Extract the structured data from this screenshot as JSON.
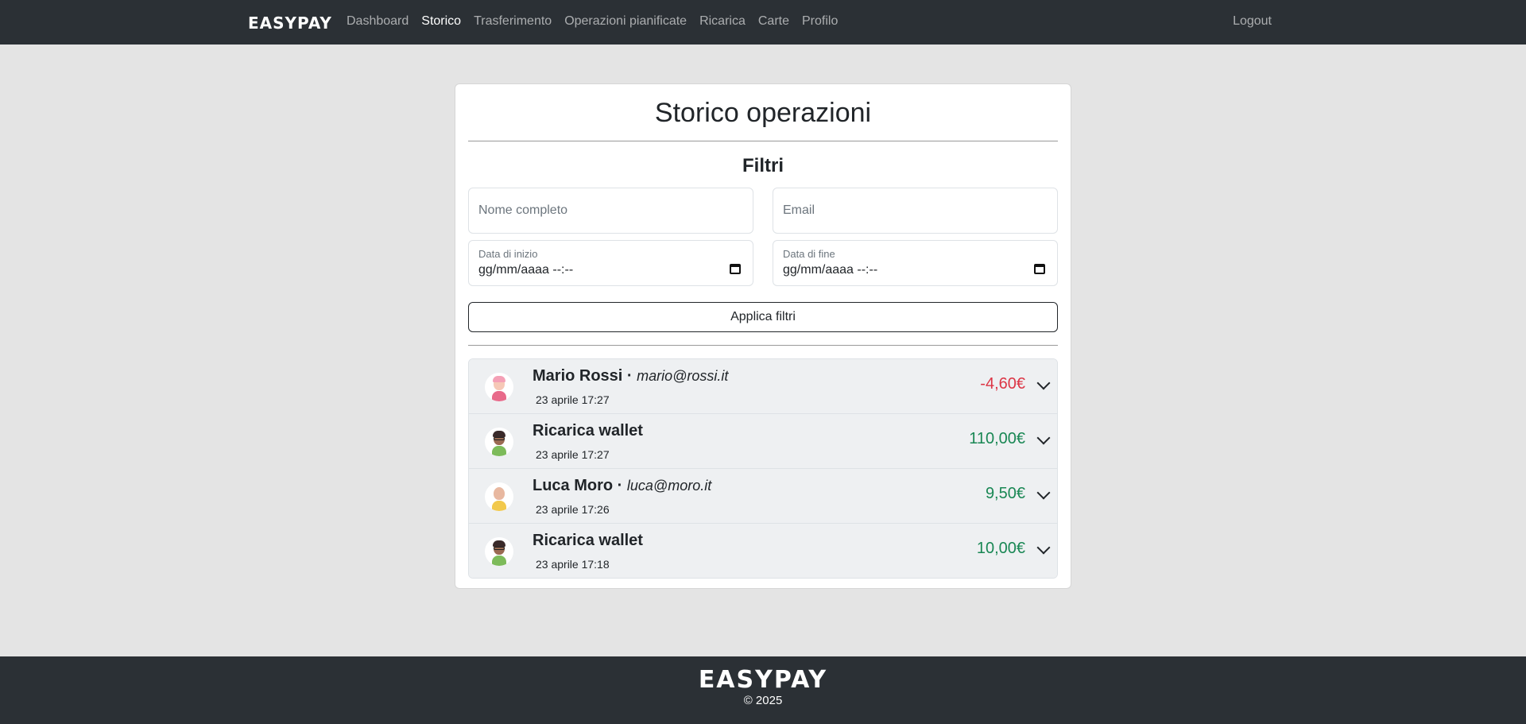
{
  "nav": {
    "brand": "EASYPAY",
    "links": [
      "Dashboard",
      "Storico",
      "Trasferimento",
      "Operazioni pianificate",
      "Ricarica",
      "Carte",
      "Profilo"
    ],
    "active": "Storico",
    "logout": "Logout"
  },
  "main": {
    "title": "Storico operazioni",
    "filters_title": "Filtri",
    "name_placeholder": "Nome completo",
    "email_placeholder": "Email",
    "start_label": "Data di inizio",
    "start_value": "gg/mm/aaaa --:--",
    "end_label": "Data di fine",
    "end_value": "gg/mm/aaaa --:--",
    "apply_label": "Applica filtri"
  },
  "transactions": [
    {
      "name": "Mario Rossi",
      "separator": " · ",
      "email": "mario@rossi.it",
      "date": "23 aprile 17:27",
      "amount": "-4,60€",
      "type": "neg",
      "avatar": "pink-haired-avatar"
    },
    {
      "name": "Ricarica wallet",
      "separator": "",
      "email": "",
      "date": "23 aprile 17:27",
      "amount": "110,00€",
      "type": "pos",
      "avatar": "glasses-avatar"
    },
    {
      "name": "Luca Moro",
      "separator": " · ",
      "email": "luca@moro.it",
      "date": "23 aprile 17:26",
      "amount": "9,50€",
      "type": "pos",
      "avatar": "bald-avatar"
    },
    {
      "name": "Ricarica wallet",
      "separator": "",
      "email": "",
      "date": "23 aprile 17:18",
      "amount": "10,00€",
      "type": "pos",
      "avatar": "glasses-avatar"
    }
  ],
  "colors": {
    "navbar": "#2b3035",
    "negative": "#dc3545",
    "positive": "#198754",
    "background": "#e4e4e4"
  },
  "footer": {
    "brand": "EASYPAY",
    "copy": "© 2025"
  }
}
